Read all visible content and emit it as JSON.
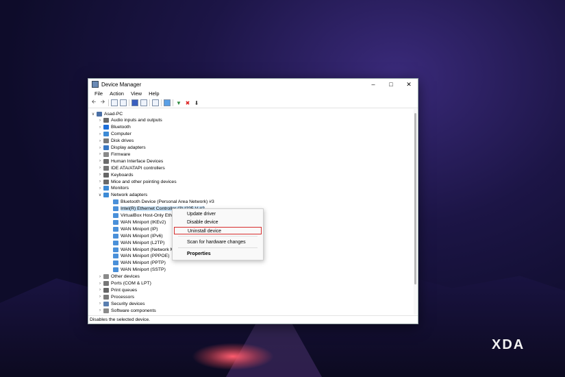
{
  "window": {
    "title": "Device Manager"
  },
  "menu": [
    "File",
    "Action",
    "View",
    "Help"
  ],
  "tree": {
    "root": "Asad-PC",
    "categories_top": [
      {
        "label": "Audio inputs and outputs",
        "color": "#6a6a6a"
      },
      {
        "label": "Bluetooth",
        "color": "#1e6fd9"
      },
      {
        "label": "Computer",
        "color": "#3d8bd6"
      },
      {
        "label": "Disk drives",
        "color": "#7a7a7a"
      },
      {
        "label": "Display adapters",
        "color": "#3a78c3"
      },
      {
        "label": "Firmware",
        "color": "#8a8a8a"
      },
      {
        "label": "Human Interface Devices",
        "color": "#6d6d6d"
      },
      {
        "label": "IDE ATA/ATAPI controllers",
        "color": "#777777"
      },
      {
        "label": "Keyboards",
        "color": "#666666"
      },
      {
        "label": "Mice and other pointing devices",
        "color": "#6a6a6a"
      },
      {
        "label": "Monitors",
        "color": "#3d8bd6"
      }
    ],
    "network": {
      "label": "Network adapters",
      "children": [
        "Bluetooth Device (Personal Area Network) #3",
        "Intel(R) Ethernet Controller (3) I225-V #2",
        "VirtualBox Host-Only Ethe",
        "WAN Miniport (IKEv2)",
        "WAN Miniport (IP)",
        "WAN Miniport (IPv6)",
        "WAN Miniport (L2TP)",
        "WAN Miniport (Network M",
        "WAN Miniport (PPPOE)",
        "WAN Miniport (PPTP)",
        "WAN Miniport (SSTP)"
      ]
    },
    "categories_bottom": [
      {
        "label": "Other devices",
        "color": "#8a8a8a"
      },
      {
        "label": "Ports (COM & LPT)",
        "color": "#777777"
      },
      {
        "label": "Print queues",
        "color": "#666666"
      },
      {
        "label": "Processors",
        "color": "#7a7a7a"
      },
      {
        "label": "Security devices",
        "color": "#5a7fb0"
      },
      {
        "label": "Software components",
        "color": "#8a8a8a"
      }
    ]
  },
  "context_menu": {
    "items": [
      "Update driver",
      "Disable device",
      "Uninstall device",
      "Scan for hardware changes",
      "Properties"
    ],
    "highlight_color": "#d62b2b"
  },
  "status": "Disables the selected device.",
  "brand": "XDA"
}
